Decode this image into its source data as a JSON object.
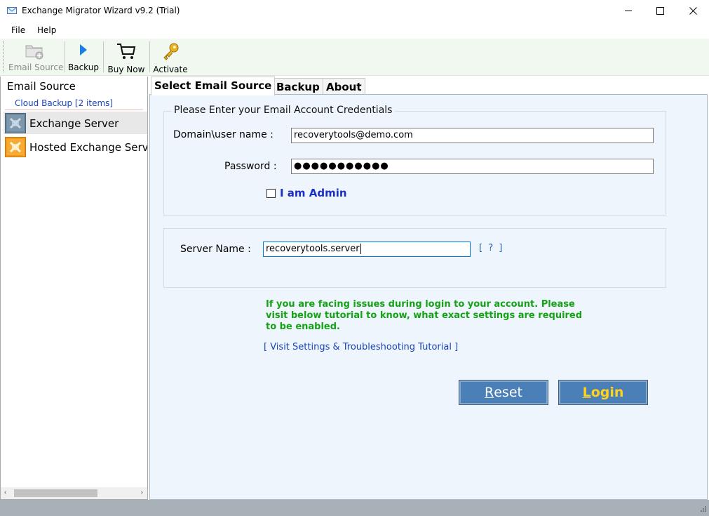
{
  "window": {
    "title": "Exchange Migrator Wizard v9.2 (Trial)",
    "controls": {
      "minimize": "—",
      "maximize": "☐",
      "close": "✕"
    }
  },
  "menu": {
    "file": "File",
    "help": "Help"
  },
  "toolbar": {
    "email_source": "Email Source",
    "backup": "Backup",
    "buy_now": "Buy Now",
    "activate": "Activate"
  },
  "sidebar": {
    "header": "Email Source",
    "group": "Cloud Backup [2 items]",
    "items": [
      {
        "label": "Exchange Server",
        "icon": "exchange-server-icon",
        "selected": true
      },
      {
        "label": "Hosted Exchange Serv",
        "icon": "hosted-exchange-icon",
        "selected": false
      }
    ],
    "scroll_left": "‹",
    "scroll_right": "›"
  },
  "tabs": [
    {
      "label": "Select Email Source",
      "active": true
    },
    {
      "label": "Backup",
      "active": false
    },
    {
      "label": "About",
      "active": false
    }
  ],
  "credentials": {
    "legend": "Please Enter your Email Account Credentials",
    "domain_label": "Domain\\user name :",
    "domain_value": "recoverytools@demo.com",
    "password_label": "Password :",
    "password_value": "●●●●●●●●●●●",
    "admin_label": "I am Admin",
    "admin_checked": false
  },
  "server": {
    "label": "Server Name :",
    "value": "recoverytools.server",
    "help": "[ ? ]"
  },
  "notice": {
    "line1": "If you are facing issues during login to your account. Please",
    "line2": "visit below tutorial to know, what exact settings are required",
    "line3": "to be enabled."
  },
  "tutorial_link": "[ Visit Settings & Troubleshooting Tutorial ]",
  "buttons": {
    "reset_mnemonic": "R",
    "reset_rest": "eset",
    "login_mnemonic": "L",
    "login_rest": "ogin"
  },
  "colors": {
    "accent": "#4a7fb8",
    "login_text": "#ffd21e",
    "notice_text": "#15a315",
    "link": "#1a44b8",
    "content_bg": "#eef5fc",
    "statusbar": "#a9b1b8"
  }
}
